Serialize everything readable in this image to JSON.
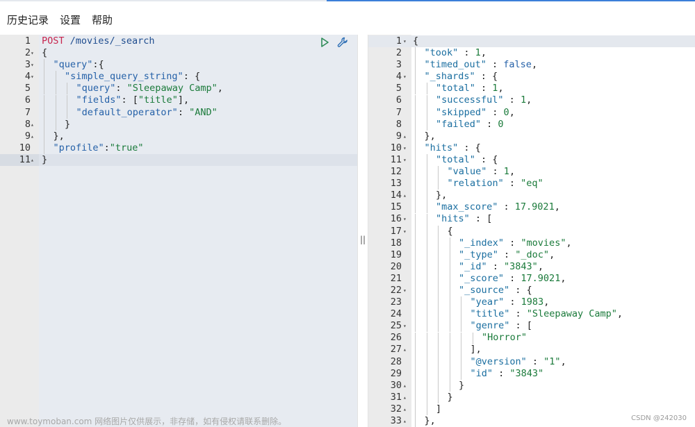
{
  "menu": {
    "history": "历史记录",
    "settings": "设置",
    "help": "帮助"
  },
  "request": {
    "lines": [
      {
        "num": "1",
        "fold": "",
        "indent": 0,
        "tokens": [
          [
            "method",
            "POST"
          ],
          [
            "url",
            " /movies/_search"
          ]
        ]
      },
      {
        "num": "2",
        "fold": "▾",
        "indent": 0,
        "tokens": [
          [
            "punc",
            "{"
          ]
        ]
      },
      {
        "num": "3",
        "fold": "▾",
        "indent": 1,
        "tokens": [
          [
            "key",
            "\"query\""
          ],
          [
            "punc",
            ":{"
          ]
        ]
      },
      {
        "num": "4",
        "fold": "▾",
        "indent": 2,
        "tokens": [
          [
            "key",
            "\"simple_query_string\""
          ],
          [
            "punc",
            ": {"
          ]
        ]
      },
      {
        "num": "5",
        "fold": "",
        "indent": 3,
        "tokens": [
          [
            "key",
            "\"query\""
          ],
          [
            "punc",
            ": "
          ],
          [
            "str",
            "\"Sleepaway Camp\""
          ],
          [
            "punc",
            ","
          ]
        ]
      },
      {
        "num": "6",
        "fold": "",
        "indent": 3,
        "tokens": [
          [
            "key",
            "\"fields\""
          ],
          [
            "punc",
            ": ["
          ],
          [
            "str",
            "\"title\""
          ],
          [
            "punc",
            "],"
          ]
        ]
      },
      {
        "num": "7",
        "fold": "",
        "indent": 3,
        "tokens": [
          [
            "key",
            "\"default_operator\""
          ],
          [
            "punc",
            ": "
          ],
          [
            "str",
            "\"AND\""
          ]
        ]
      },
      {
        "num": "8",
        "fold": "▴",
        "indent": 2,
        "tokens": [
          [
            "punc",
            "}"
          ]
        ]
      },
      {
        "num": "9",
        "fold": "▴",
        "indent": 1,
        "tokens": [
          [
            "punc",
            "},"
          ]
        ]
      },
      {
        "num": "10",
        "fold": "",
        "indent": 1,
        "tokens": [
          [
            "key",
            "\"profile\""
          ],
          [
            "punc",
            ":"
          ],
          [
            "str",
            "\"true\""
          ]
        ]
      },
      {
        "num": "11",
        "fold": "▴",
        "indent": 0,
        "tokens": [
          [
            "punc",
            "}"
          ]
        ],
        "active": true
      }
    ]
  },
  "response": {
    "lines": [
      {
        "num": "1",
        "fold": "▾",
        "indent": 0,
        "tokens": [
          [
            "punc",
            "{"
          ]
        ],
        "active": true
      },
      {
        "num": "2",
        "fold": "",
        "indent": 1,
        "tokens": [
          [
            "kkey",
            "\"took\""
          ],
          [
            "punc",
            " : "
          ],
          [
            "num",
            "1"
          ],
          [
            "punc",
            ","
          ]
        ]
      },
      {
        "num": "3",
        "fold": "",
        "indent": 1,
        "tokens": [
          [
            "kkey",
            "\"timed_out\""
          ],
          [
            "punc",
            " : "
          ],
          [
            "bool",
            "false"
          ],
          [
            "punc",
            ","
          ]
        ]
      },
      {
        "num": "4",
        "fold": "▾",
        "indent": 1,
        "tokens": [
          [
            "kkey",
            "\"_shards\""
          ],
          [
            "punc",
            " : {"
          ]
        ]
      },
      {
        "num": "5",
        "fold": "",
        "indent": 2,
        "tokens": [
          [
            "kkey",
            "\"total\""
          ],
          [
            "punc",
            " : "
          ],
          [
            "num",
            "1"
          ],
          [
            "punc",
            ","
          ]
        ]
      },
      {
        "num": "6",
        "fold": "",
        "indent": 2,
        "tokens": [
          [
            "kkey",
            "\"successful\""
          ],
          [
            "punc",
            " : "
          ],
          [
            "num",
            "1"
          ],
          [
            "punc",
            ","
          ]
        ]
      },
      {
        "num": "7",
        "fold": "",
        "indent": 2,
        "tokens": [
          [
            "kkey",
            "\"skipped\""
          ],
          [
            "punc",
            " : "
          ],
          [
            "num",
            "0"
          ],
          [
            "punc",
            ","
          ]
        ]
      },
      {
        "num": "8",
        "fold": "",
        "indent": 2,
        "tokens": [
          [
            "kkey",
            "\"failed\""
          ],
          [
            "punc",
            " : "
          ],
          [
            "num",
            "0"
          ]
        ]
      },
      {
        "num": "9",
        "fold": "▴",
        "indent": 1,
        "tokens": [
          [
            "punc",
            "},"
          ]
        ]
      },
      {
        "num": "10",
        "fold": "▾",
        "indent": 1,
        "tokens": [
          [
            "kkey",
            "\"hits\""
          ],
          [
            "punc",
            " : {"
          ]
        ]
      },
      {
        "num": "11",
        "fold": "▾",
        "indent": 2,
        "tokens": [
          [
            "kkey",
            "\"total\""
          ],
          [
            "punc",
            " : {"
          ]
        ]
      },
      {
        "num": "12",
        "fold": "",
        "indent": 3,
        "tokens": [
          [
            "kkey",
            "\"value\""
          ],
          [
            "punc",
            " : "
          ],
          [
            "num",
            "1"
          ],
          [
            "punc",
            ","
          ]
        ]
      },
      {
        "num": "13",
        "fold": "",
        "indent": 3,
        "tokens": [
          [
            "kkey",
            "\"relation\""
          ],
          [
            "punc",
            " : "
          ],
          [
            "str",
            "\"eq\""
          ]
        ]
      },
      {
        "num": "14",
        "fold": "▴",
        "indent": 2,
        "tokens": [
          [
            "punc",
            "},"
          ]
        ]
      },
      {
        "num": "15",
        "fold": "",
        "indent": 2,
        "tokens": [
          [
            "kkey",
            "\"max_score\""
          ],
          [
            "punc",
            " : "
          ],
          [
            "num",
            "17.9021"
          ],
          [
            "punc",
            ","
          ]
        ]
      },
      {
        "num": "16",
        "fold": "▾",
        "indent": 2,
        "tokens": [
          [
            "kkey",
            "\"hits\""
          ],
          [
            "punc",
            " : ["
          ]
        ]
      },
      {
        "num": "17",
        "fold": "▾",
        "indent": 3,
        "tokens": [
          [
            "punc",
            "{"
          ]
        ]
      },
      {
        "num": "18",
        "fold": "",
        "indent": 4,
        "tokens": [
          [
            "kkey",
            "\"_index\""
          ],
          [
            "punc",
            " : "
          ],
          [
            "str",
            "\"movies\""
          ],
          [
            "punc",
            ","
          ]
        ]
      },
      {
        "num": "19",
        "fold": "",
        "indent": 4,
        "tokens": [
          [
            "kkey",
            "\"_type\""
          ],
          [
            "punc",
            " : "
          ],
          [
            "str",
            "\"_doc\""
          ],
          [
            "punc",
            ","
          ]
        ]
      },
      {
        "num": "20",
        "fold": "",
        "indent": 4,
        "tokens": [
          [
            "kkey",
            "\"_id\""
          ],
          [
            "punc",
            " : "
          ],
          [
            "str",
            "\"3843\""
          ],
          [
            "punc",
            ","
          ]
        ]
      },
      {
        "num": "21",
        "fold": "",
        "indent": 4,
        "tokens": [
          [
            "kkey",
            "\"_score\""
          ],
          [
            "punc",
            " : "
          ],
          [
            "num",
            "17.9021"
          ],
          [
            "punc",
            ","
          ]
        ]
      },
      {
        "num": "22",
        "fold": "▾",
        "indent": 4,
        "tokens": [
          [
            "kkey",
            "\"_source\""
          ],
          [
            "punc",
            " : {"
          ]
        ]
      },
      {
        "num": "23",
        "fold": "",
        "indent": 5,
        "tokens": [
          [
            "kkey",
            "\"year\""
          ],
          [
            "punc",
            " : "
          ],
          [
            "num",
            "1983"
          ],
          [
            "punc",
            ","
          ]
        ]
      },
      {
        "num": "24",
        "fold": "",
        "indent": 5,
        "tokens": [
          [
            "kkey",
            "\"title\""
          ],
          [
            "punc",
            " : "
          ],
          [
            "str",
            "\"Sleepaway Camp\""
          ],
          [
            "punc",
            ","
          ]
        ]
      },
      {
        "num": "25",
        "fold": "▾",
        "indent": 5,
        "tokens": [
          [
            "kkey",
            "\"genre\""
          ],
          [
            "punc",
            " : ["
          ]
        ]
      },
      {
        "num": "26",
        "fold": "",
        "indent": 6,
        "tokens": [
          [
            "str",
            "\"Horror\""
          ]
        ]
      },
      {
        "num": "27",
        "fold": "▴",
        "indent": 5,
        "tokens": [
          [
            "punc",
            "],"
          ]
        ]
      },
      {
        "num": "28",
        "fold": "",
        "indent": 5,
        "tokens": [
          [
            "kkey",
            "\"@version\""
          ],
          [
            "punc",
            " : "
          ],
          [
            "str",
            "\"1\""
          ],
          [
            "punc",
            ","
          ]
        ]
      },
      {
        "num": "29",
        "fold": "",
        "indent": 5,
        "tokens": [
          [
            "kkey",
            "\"id\""
          ],
          [
            "punc",
            " : "
          ],
          [
            "str",
            "\"3843\""
          ]
        ]
      },
      {
        "num": "30",
        "fold": "▴",
        "indent": 4,
        "tokens": [
          [
            "punc",
            "}"
          ]
        ]
      },
      {
        "num": "31",
        "fold": "▴",
        "indent": 3,
        "tokens": [
          [
            "punc",
            "}"
          ]
        ]
      },
      {
        "num": "32",
        "fold": "▴",
        "indent": 2,
        "tokens": [
          [
            "punc",
            "]"
          ]
        ]
      },
      {
        "num": "33",
        "fold": "▴",
        "indent": 1,
        "tokens": [
          [
            "punc",
            "},"
          ]
        ]
      }
    ]
  },
  "icons": {
    "run": "play-icon",
    "wrench": "wrench-icon"
  },
  "colors": {
    "accent": "#3b7fd9",
    "method": "#c7254e",
    "key": "#2561a8",
    "string": "#1a7a3a"
  },
  "divider_handle": "||",
  "watermark": {
    "left": "www.toymoban.com 网络图片仅供展示，非存储，如有侵权请联系删除。",
    "right": "CSDN @242030"
  }
}
